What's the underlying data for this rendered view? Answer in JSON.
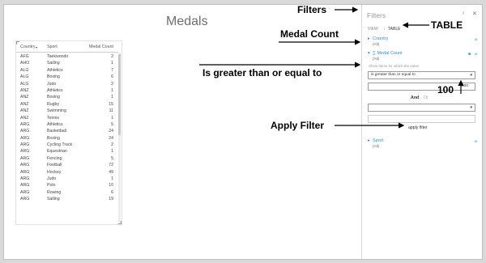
{
  "report": {
    "title": "Medals"
  },
  "table": {
    "headers": [
      "Country",
      "Sport",
      "Medal Count"
    ],
    "sort_icon": "sort-down-icon",
    "rows": [
      [
        "AFG",
        "Taekwondo",
        "2"
      ],
      [
        "AHO",
        "Sailing",
        "1"
      ],
      [
        "ALG",
        "Athletics",
        "7"
      ],
      [
        "ALG",
        "Boxing",
        "6"
      ],
      [
        "ALG",
        "Judo",
        "2"
      ],
      [
        "ANZ",
        "Athletics",
        "1"
      ],
      [
        "ANZ",
        "Boxing",
        "1"
      ],
      [
        "ANZ",
        "Rugby",
        "15"
      ],
      [
        "ANZ",
        "Swimming",
        "11"
      ],
      [
        "ANZ",
        "Tennis",
        "1"
      ],
      [
        "ARG",
        "Athletics",
        "5"
      ],
      [
        "ARG",
        "Basketball",
        "24"
      ],
      [
        "ARG",
        "Boxing",
        "24"
      ],
      [
        "ARG",
        "Cycling Track",
        "2"
      ],
      [
        "ARG",
        "Equestrian",
        "1"
      ],
      [
        "ARG",
        "Fencing",
        "5"
      ],
      [
        "ARG",
        "Football",
        "72"
      ],
      [
        "ARG",
        "Hockey",
        "49"
      ],
      [
        "ARG",
        "Judo",
        "1"
      ],
      [
        "ARG",
        "Polo",
        "10"
      ],
      [
        "ARG",
        "Rowing",
        "6"
      ],
      [
        "ARG",
        "Sailing",
        "19"
      ]
    ]
  },
  "filters_pane": {
    "title": "Filters",
    "controls": {
      "back": "‹",
      "close": "✕"
    },
    "tabs": {
      "view": "VIEW",
      "separator": "|",
      "table": "TABLE"
    },
    "country": {
      "label": "Country",
      "sub": "(All)"
    },
    "medal_count": {
      "label": "∑ Medal Count",
      "sub": "(All)",
      "hint": "Show items for which the value",
      "operator": "is greater than or equal to",
      "value": "100"
    },
    "logic": {
      "and": "And",
      "or": "Or"
    },
    "second_value": "",
    "apply": "apply filter",
    "sport": {
      "label": "Sport",
      "sub": "(All)"
    }
  },
  "annotations": {
    "filters": "Filters",
    "table": "TABLE",
    "medal_count": "Medal Count",
    "operator": "Is greater than or equal to",
    "value": "100",
    "apply": "Apply Filter"
  },
  "colors": {
    "accent": "#2e8fd4",
    "pane_border": "#d8d8d8",
    "background": "#d9d9d9"
  }
}
